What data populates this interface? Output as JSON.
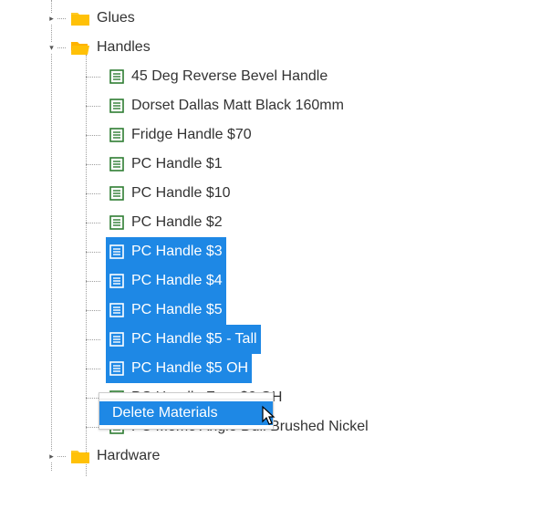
{
  "tree": {
    "folders": [
      {
        "label": "Glues",
        "expanded": false
      },
      {
        "label": "Handles",
        "expanded": true
      },
      {
        "label": "Hardware",
        "expanded": false
      }
    ],
    "handles_children": [
      {
        "label": "45 Deg Reverse Bevel Handle",
        "selected": false
      },
      {
        "label": "Dorset Dallas Matt Black 160mm",
        "selected": false
      },
      {
        "label": "Fridge Handle $70",
        "selected": false
      },
      {
        "label": "PC Handle $1",
        "selected": false
      },
      {
        "label": "PC Handle $10",
        "selected": false
      },
      {
        "label": "PC Handle $2",
        "selected": false
      },
      {
        "label": "PC Handle $3",
        "selected": true
      },
      {
        "label": "PC Handle $4",
        "selected": true
      },
      {
        "label": "PC Handle $5",
        "selected": true
      },
      {
        "label": "PC Handle $5 - Tall",
        "selected": true
      },
      {
        "label": "PC Handle $5 OH",
        "selected": true
      },
      {
        "label": "PC Handle Free $0 OH",
        "selected": false
      },
      {
        "label": "PC Momo Angle Dull Brushed Nickel",
        "selected": false
      }
    ]
  },
  "contextMenu": {
    "items": [
      {
        "label": "Delete Materials",
        "hover": true
      }
    ]
  },
  "colors": {
    "selection": "#1e88e5",
    "folder": "#ffc107",
    "itemIcon": "#2e7d32"
  }
}
